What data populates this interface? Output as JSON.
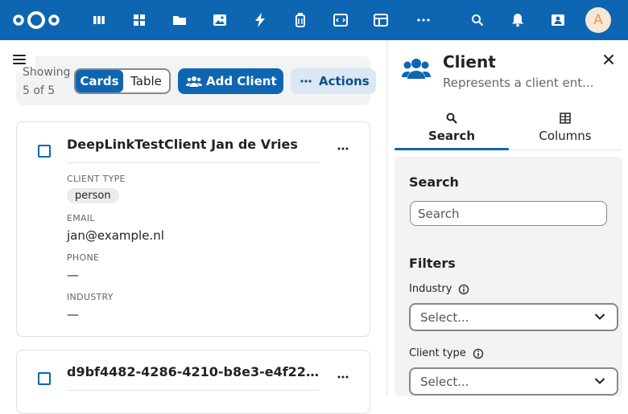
{
  "topbar": {
    "apps": [
      "dashboard-icon",
      "grid-icon",
      "files-icon",
      "photos-icon",
      "activity-icon",
      "deck-icon",
      "code-icon",
      "tables-icon",
      "more-apps-icon"
    ],
    "avatar_letter": "A"
  },
  "toolbar": {
    "showing_label": "Showing 5 of 5",
    "view_cards": "Cards",
    "view_table": "Table",
    "add_client": "Add Client",
    "actions": "Actions"
  },
  "cards": [
    {
      "title": "DeepLinkTestClient Jan de Vries",
      "fields": {
        "client_type_label": "CLIENT TYPE",
        "client_type": "person",
        "email_label": "EMAIL",
        "email": "jan@example.nl",
        "phone_label": "PHONE",
        "phone": "—",
        "industry_label": "INDUSTRY",
        "industry": "—"
      }
    },
    {
      "title": "d9bf4482-4286-4210-b8e3-e4f22..."
    }
  ],
  "sidebar": {
    "title": "Client",
    "subtitle": "Represents a client ent...",
    "tabs": [
      "Search",
      "Columns"
    ],
    "search_heading": "Search",
    "search_placeholder": "Search",
    "filters_heading": "Filters",
    "filters": [
      {
        "label": "Industry",
        "value": "Select..."
      },
      {
        "label": "Client type",
        "value": "Select..."
      }
    ]
  },
  "colors": {
    "brand": "#0e66b2",
    "avatar_bg": "#f9e7d6",
    "avatar_fg": "#e39a4f"
  }
}
